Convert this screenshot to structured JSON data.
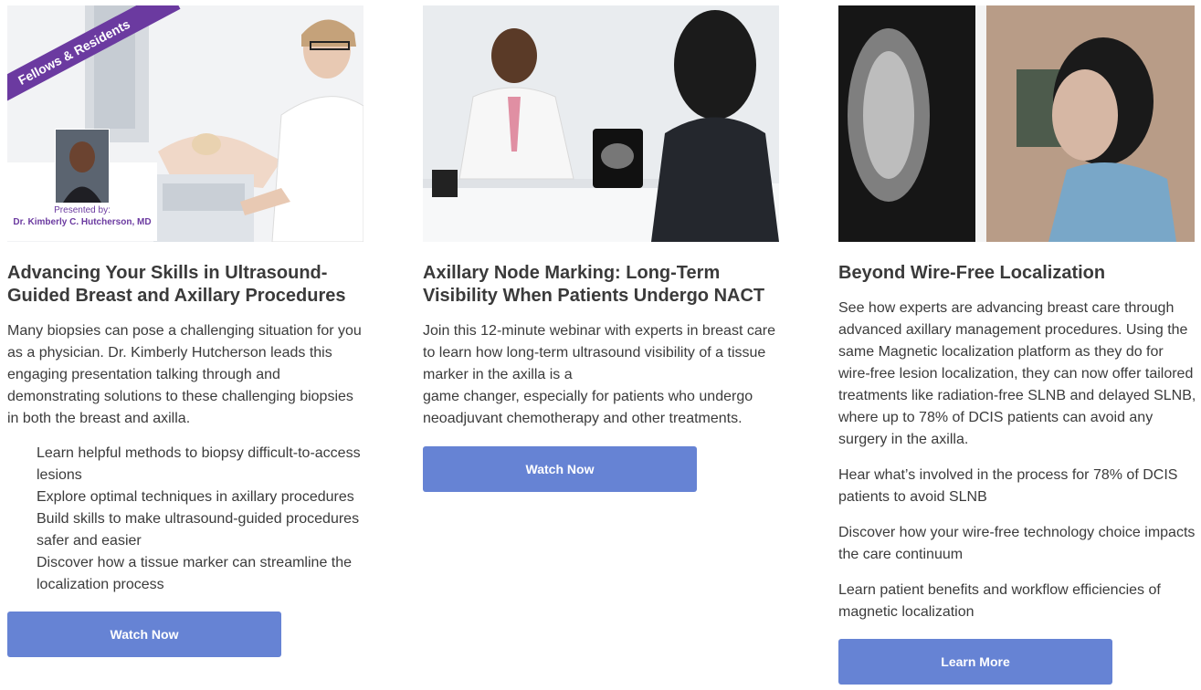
{
  "cards": [
    {
      "image": {
        "alt": "Doctor performing breast ultrasound on patient",
        "ribbon": "Fellows & Residents",
        "presented_label": "Presented by:",
        "presenter_name": "Dr. Kimberly C. Hutcherson, MD"
      },
      "title": "Advancing Your Skills in Ultrasound-Guided Breast and Axillary Procedures",
      "description": "Many biopsies can pose a challenging situation for you as a physician. Dr. Kimberly Hutcherson leads this engaging presentation talking through and demonstrating solutions to these challenging biopsies in both the breast and axilla.",
      "bullets": [
        "Learn helpful methods to biopsy difficult-to-access lesions",
        "Explore optimal techniques in axillary procedures",
        "Build skills to make ultrasound-guided procedures safer and easier",
        "Discover how a tissue marker can streamline the localization process"
      ],
      "button": "Watch Now"
    },
    {
      "image": {
        "alt": "Doctor showing ultrasound image on tablet to patient"
      },
      "title": "Axillary Node Marking: Long-Term Visibility When Patients Undergo NACT",
      "description_line1": "Join this 12-minute webinar with experts in breast care to learn how long-term ultrasound visibility of a tissue marker in the axilla is a",
      "description_line2": "game changer, especially for patients who undergo neoadjuvant chemotherapy and other treatments.",
      "button": "Watch Now"
    },
    {
      "image": {
        "alt": "Woman looking at mammogram on light box"
      },
      "title": "Beyond Wire-Free Localization",
      "paragraphs": [
        "See how experts are advancing breast care through advanced axillary management procedures. Using the same Magnetic localization platform as they do for wire-free lesion localization, they can now offer tailored treatments like radiation-free SLNB and delayed SLNB, where up to 78% of DCIS patients can avoid any surgery in the axilla.",
        "Hear what’s involved in the process for 78% of DCIS patients to avoid SLNB",
        "Discover how your wire-free technology choice impacts the care continuum",
        "Learn patient benefits and workflow efficiencies of magnetic localization"
      ],
      "button": "Learn More"
    }
  ]
}
